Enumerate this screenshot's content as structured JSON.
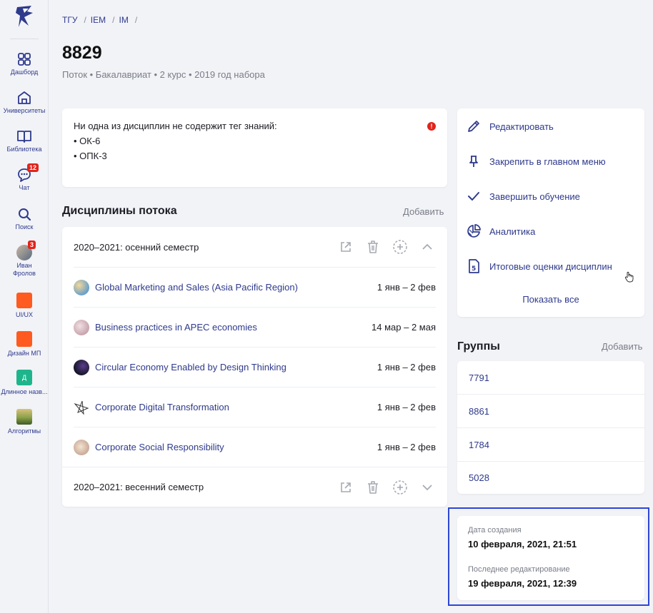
{
  "sidebar": {
    "items": [
      {
        "label": "Дашборд",
        "icon": "dashboard-icon"
      },
      {
        "label": "Университеты",
        "icon": "university-icon"
      },
      {
        "label": "Библиотека",
        "icon": "library-icon"
      },
      {
        "label": "Чат",
        "icon": "chat-icon",
        "badge": "12"
      },
      {
        "label": "Поиск",
        "icon": "search-icon"
      },
      {
        "label": "Иван Фролов",
        "icon": "avatar",
        "badge": "3"
      },
      {
        "label": "UI/UX",
        "icon": "orange-square",
        "color": "#ff5a1f"
      },
      {
        "label": "Дизайн МП",
        "icon": "orange-square",
        "color": "#ff5a1f"
      },
      {
        "label": "Длинное назв...",
        "icon": "letter-square",
        "letter": "Д",
        "color": "#1fb58c"
      },
      {
        "label": "Алгоритмы",
        "icon": "image-square"
      }
    ]
  },
  "breadcrumb": [
    "ТГУ",
    "IEM",
    "IM"
  ],
  "breadcrumb_sep": "/",
  "page": {
    "title": "8829",
    "subtitle": "Поток • Бакалавриат • 2 курс • 2019 год набора"
  },
  "warning": {
    "text": "Ни одна из дисциплин не содержит тег знаний:",
    "items": [
      "• ОК-6",
      "• ОПК-3"
    ],
    "dot": "!"
  },
  "disciplines": {
    "title": "Дисциплины потока",
    "add_label": "Добавить",
    "semesters": [
      {
        "label": "2020–2021: осенний семестр",
        "expanded": true,
        "courses": [
          {
            "name": "Global Marketing and Sales (Asia Pacific Region)",
            "dates": "1 янв – 2 фев"
          },
          {
            "name": "Business practices in APEC economies",
            "dates": "14 мар – 2 мая"
          },
          {
            "name": "Circular Economy Enabled by Design Thinking",
            "dates": "1 янв – 2 фев"
          },
          {
            "name": "Corporate Digital Transformation",
            "dates": "1 янв – 2 фев"
          },
          {
            "name": "Corporate Social Responsibility",
            "dates": "1 янв – 2 фев"
          }
        ]
      },
      {
        "label": "2020–2021: весенний семестр",
        "expanded": false
      }
    ]
  },
  "actions": {
    "items": [
      {
        "label": "Редактировать",
        "icon": "pencil-icon"
      },
      {
        "label": "Закрепить в главном меню",
        "icon": "pin-icon"
      },
      {
        "label": "Завершить обучение",
        "icon": "check-icon"
      },
      {
        "label": "Аналитика",
        "icon": "pie-chart-icon"
      },
      {
        "label": "Итоговые оценки дисциплин",
        "icon": "grade-icon"
      }
    ],
    "show_all": "Показать все"
  },
  "groups": {
    "title": "Группы",
    "add_label": "Добавить",
    "items": [
      "7791",
      "8861",
      "1784",
      "5028"
    ]
  },
  "dates": {
    "created_label": "Дата создания",
    "created_value": "10 февраля, 2021, 21:51",
    "edited_label": "Последнее редактирование",
    "edited_value": "19 февраля, 2021, 12:39"
  },
  "colors": {
    "accent": "#2e3a8c",
    "badge": "#e0241b",
    "highlight": "#2d45d6"
  }
}
